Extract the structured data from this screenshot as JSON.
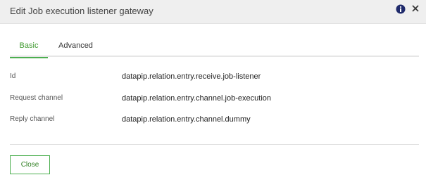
{
  "dialog": {
    "title": "Edit Job execution listener gateway"
  },
  "icons": {
    "info": "info-circle-icon",
    "close": "close-icon"
  },
  "tabs": [
    {
      "label": "Basic",
      "active": true
    },
    {
      "label": "Advanced",
      "active": false
    }
  ],
  "fields": [
    {
      "label": "Id",
      "value": "datapip.relation.entry.receive.job-listener"
    },
    {
      "label": "Request channel",
      "value": "datapip.relation.entry.channel.job-execution"
    },
    {
      "label": "Reply channel",
      "value": "datapip.relation.entry.channel.dummy"
    }
  ],
  "footer": {
    "close_label": "Close"
  },
  "colors": {
    "accent": "#4caf50",
    "header_bg": "#efefef",
    "info_icon": "#1f2a6b"
  }
}
